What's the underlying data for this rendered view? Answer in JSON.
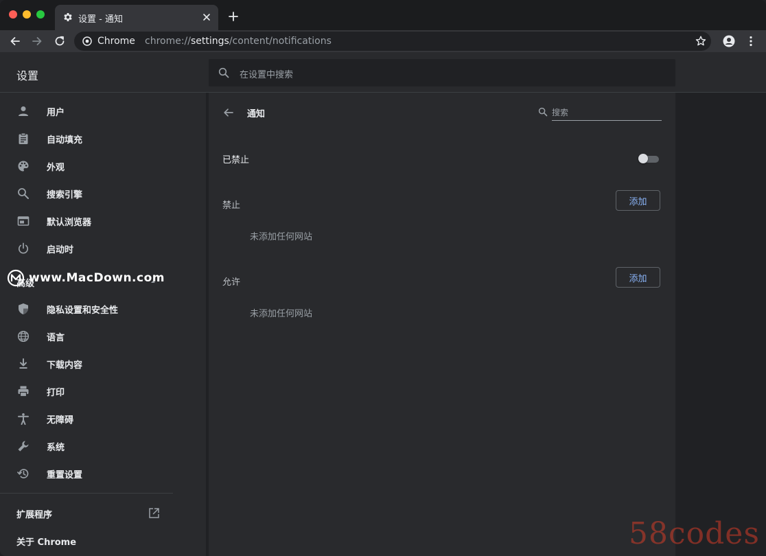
{
  "colors": {
    "accent": "#8ab4f8",
    "background": "#202124",
    "surface": "#292a2d",
    "toolbar": "#35363a",
    "text": "#e8eaed",
    "muted_text": "#9aa0a6"
  },
  "tab": {
    "title": "设置 - 通知",
    "icon": "gear-icon"
  },
  "toolbar": {
    "site_chip": "Chrome",
    "url_scheme": "chrome://",
    "url_host": "settings",
    "url_path": "/content/notifications"
  },
  "header": {
    "title": "设置",
    "search_placeholder": "在设置中搜索"
  },
  "sidebar": {
    "items": [
      {
        "label": "用户",
        "icon": "person-icon"
      },
      {
        "label": "自动填充",
        "icon": "clipboard-icon"
      },
      {
        "label": "外观",
        "icon": "palette-icon"
      },
      {
        "label": "搜索引擎",
        "icon": "search-icon"
      },
      {
        "label": "默认浏览器",
        "icon": "browser-window-icon"
      },
      {
        "label": "启动时",
        "icon": "power-icon"
      }
    ],
    "advanced_label": "高级",
    "advanced_items": [
      {
        "label": "隐私设置和安全性",
        "icon": "shield-icon"
      },
      {
        "label": "语言",
        "icon": "globe-icon"
      },
      {
        "label": "下载内容",
        "icon": "download-icon"
      },
      {
        "label": "打印",
        "icon": "printer-icon"
      },
      {
        "label": "无障碍",
        "icon": "accessibility-icon"
      },
      {
        "label": "系统",
        "icon": "wrench-icon"
      },
      {
        "label": "重置设置",
        "icon": "restore-icon"
      }
    ],
    "extensions_label": "扩展程序",
    "about_label": "关于 Chrome"
  },
  "watermarks": {
    "site": "www.MacDown.com",
    "corner": "58codes"
  },
  "main": {
    "title": "通知",
    "search_placeholder": "搜索",
    "blocked_toggle_label": "已禁止",
    "blocked_toggle_on": false,
    "block_section": {
      "title": "禁止",
      "add_label": "添加",
      "empty_message": "未添加任何网站"
    },
    "allow_section": {
      "title": "允许",
      "add_label": "添加",
      "empty_message": "未添加任何网站"
    }
  }
}
